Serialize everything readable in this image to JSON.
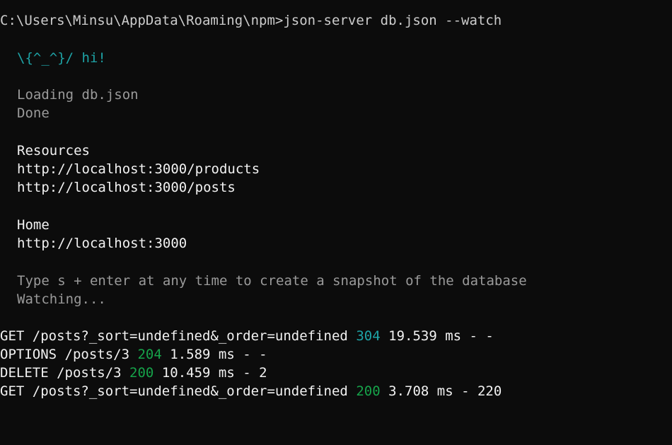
{
  "terminal": {
    "prompt_line": "C:\\Users\\Minsu\\AppData\\Roaming\\npm>json-server db.json --watch",
    "greeting": "\\{^_^}/ hi!",
    "loading": "Loading db.json",
    "done": "Done",
    "resources_heading": "Resources",
    "resources": [
      "http://localhost:3000/products",
      "http://localhost:3000/posts"
    ],
    "home_heading": "Home",
    "home_url": "http://localhost:3000",
    "hint": "Type s + enter at any time to create a snapshot of the database",
    "watching": "Watching...",
    "log": [
      {
        "request": "GET /posts?_sort=undefined&_order=undefined",
        "status": "304",
        "rest": "19.539 ms - -"
      },
      {
        "request": "OPTIONS /posts/3",
        "status": "204",
        "rest": "1.589 ms - -"
      },
      {
        "request": "DELETE /posts/3",
        "status": "200",
        "rest": "10.459 ms - 2"
      },
      {
        "request": "GET /posts?_sort=undefined&_order=undefined",
        "status": "200",
        "rest": "3.708 ms - 220"
      }
    ]
  },
  "colors": {
    "background": "#0c0c0c",
    "text": "#cccccc",
    "greeting": "#3a96dd",
    "status_304": "#1ea3a6",
    "status_2xx": "#16a34a"
  }
}
